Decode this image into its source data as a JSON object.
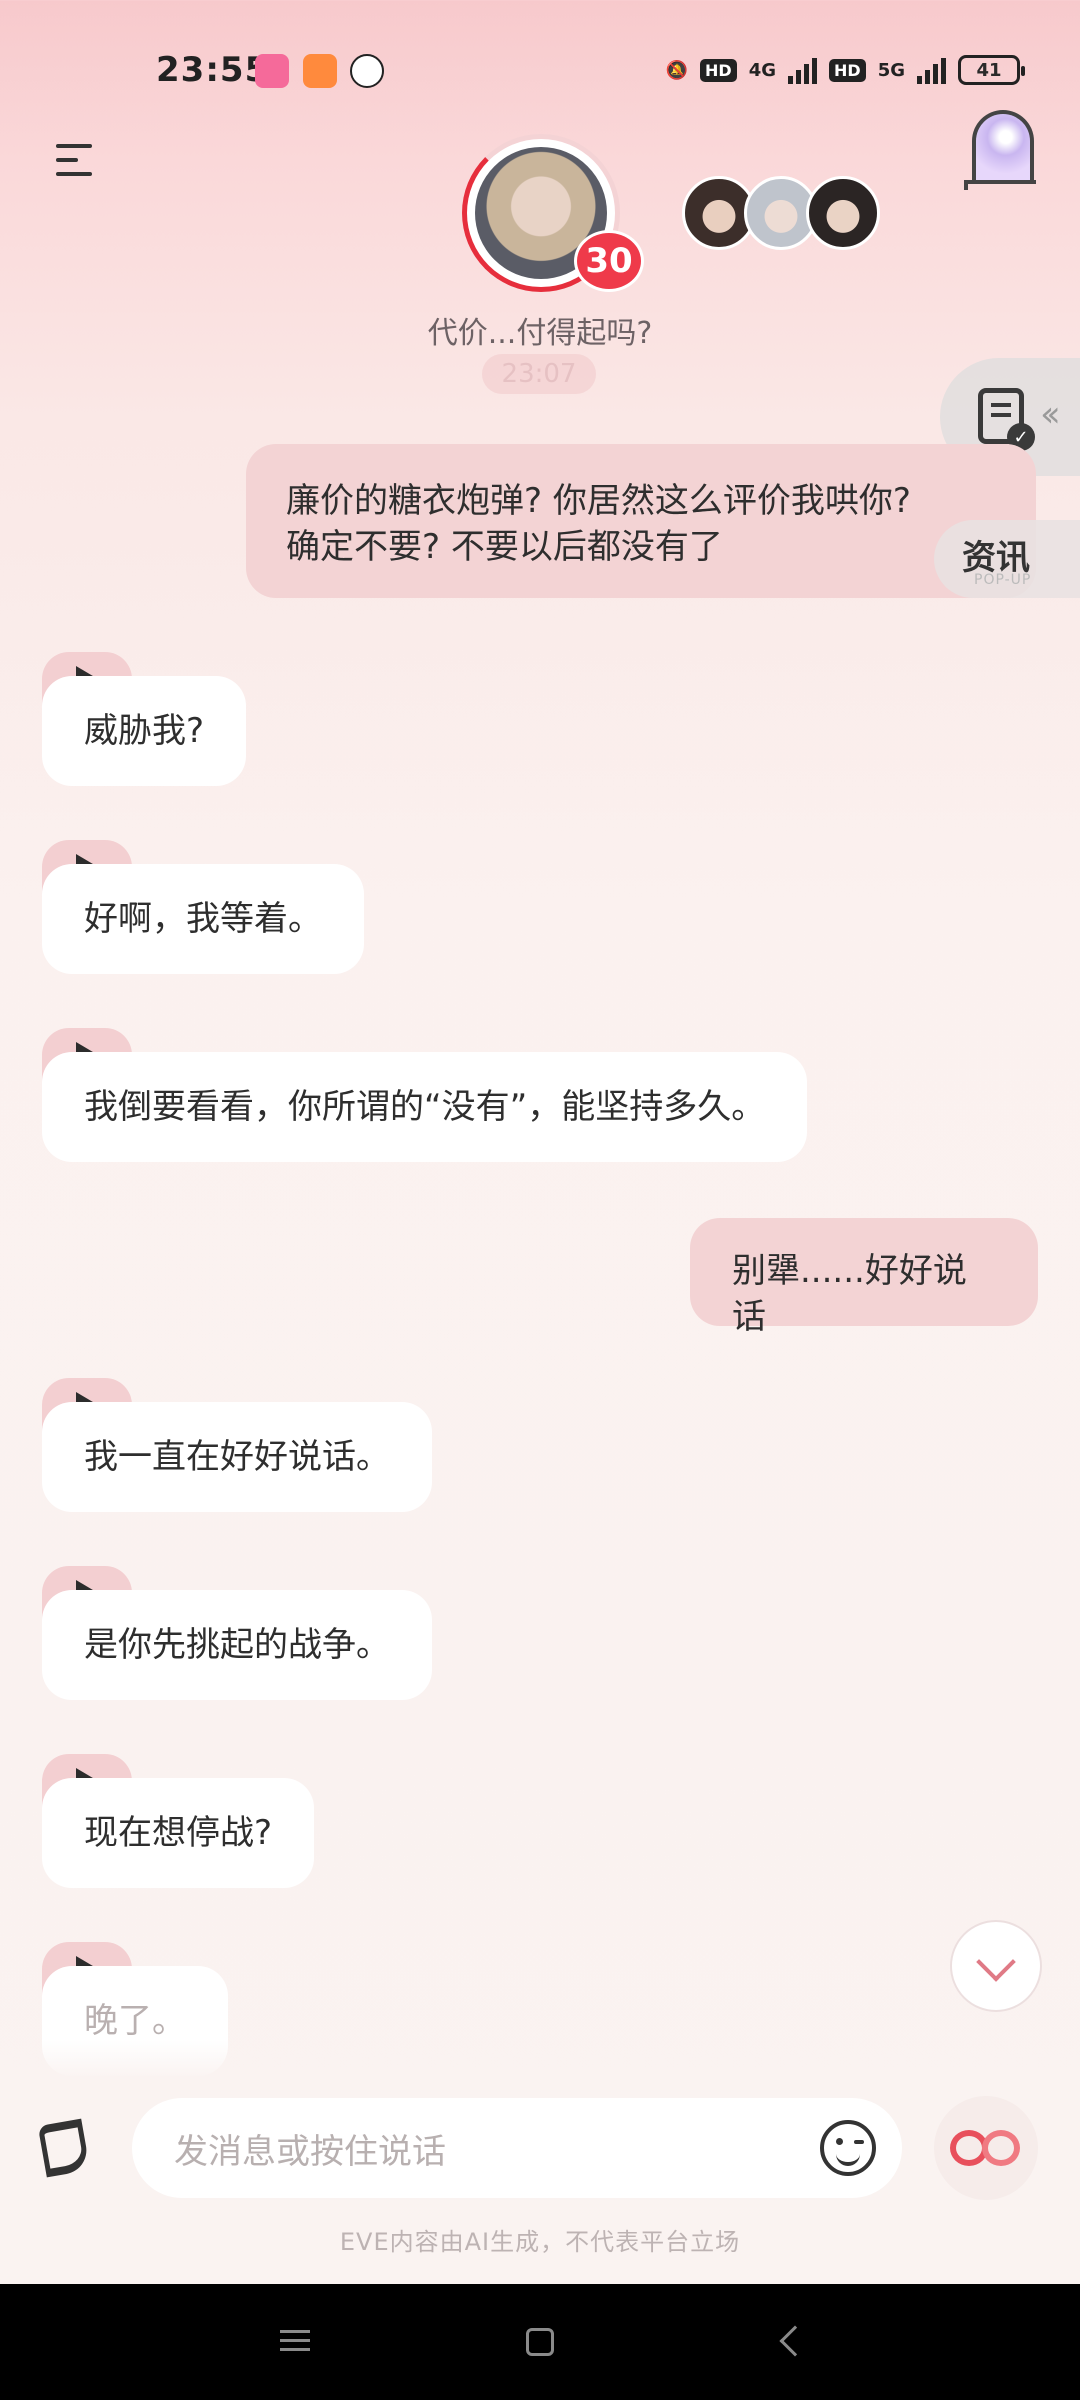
{
  "status_bar": {
    "time": "23:55",
    "net_4g": "4G",
    "net_5g": "5G",
    "hd1": "HD",
    "hd2": "HD",
    "battery": "41"
  },
  "header": {
    "level": "30",
    "subtitle": "代价...付得起吗?",
    "ghost_time": "23:07"
  },
  "side": {
    "news_label": "资讯",
    "news_sub": "POP-UP"
  },
  "messages": [
    {
      "role": "user",
      "text_line1": "廉价的糖衣炮弹? 你居然这么评价我哄你?",
      "text_line2": "确定不要? 不要以后都没有了"
    },
    {
      "role": "ai",
      "text": "威胁我?"
    },
    {
      "role": "ai",
      "text": "好啊，我等着。"
    },
    {
      "role": "ai",
      "text": "我倒要看看，你所谓的“没有”，能坚持多久。"
    },
    {
      "role": "user",
      "text": "别犟......好好说话"
    },
    {
      "role": "ai",
      "text": "我一直在好好说话。"
    },
    {
      "role": "ai",
      "text": "是你先挑起的战争。"
    },
    {
      "role": "ai",
      "text": "现在想停战?"
    },
    {
      "role": "ai",
      "text": "晚了。"
    }
  ],
  "input": {
    "placeholder": "发消息或按住说话"
  },
  "disclaimer": "EVE内容由AI生成，不代表平台立场",
  "colors": {
    "accent": "#e8505c",
    "user_bubble": "#f3d3d4",
    "ai_bubble": "#ffffff"
  }
}
